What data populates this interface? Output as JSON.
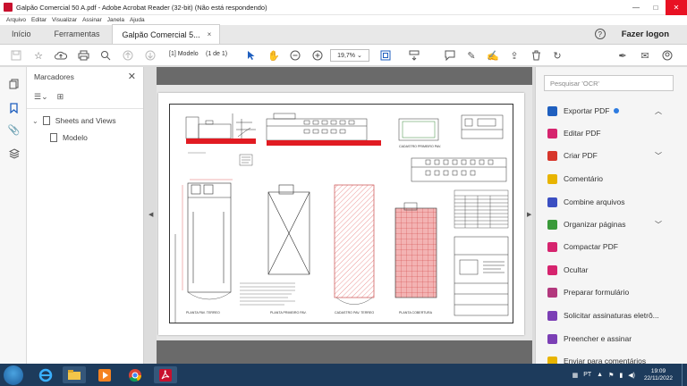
{
  "window": {
    "title": "Galpão Comercial 50 A.pdf - Adobe Acrobat Reader (32-bit) (Não está respondendo)",
    "minimize": "—",
    "maximize": "□",
    "close": "✕"
  },
  "menu": [
    "Arquivo",
    "Editar",
    "Visualizar",
    "Assinar",
    "Janela",
    "Ajuda"
  ],
  "tabs": {
    "home": "Início",
    "tools": "Ferramentas",
    "document": "Galpão Comercial 5...",
    "document_close": "×",
    "help": "?",
    "login": "Fazer logon"
  },
  "toolbar": {
    "page_label": "[1] Modelo",
    "page_count": "(1 de 1)",
    "zoom": "19,7%"
  },
  "bookmarks": {
    "header": "Marcadores",
    "close": "✕",
    "items": [
      {
        "label": "Sheets and Views",
        "expanded": true
      },
      {
        "label": "Modelo"
      }
    ]
  },
  "tools_pane": {
    "search_placeholder": "Pesquisar 'OCR'",
    "items": [
      {
        "label": "Exportar PDF",
        "color": "#1f5fbf",
        "chevron": "up"
      },
      {
        "label": "Editar PDF",
        "color": "#d6246e"
      },
      {
        "label": "Criar PDF",
        "color": "#d7362b",
        "chevron": "down"
      },
      {
        "label": "Comentário",
        "color": "#e8b400"
      },
      {
        "label": "Combine arquivos",
        "color": "#3b4fc2"
      },
      {
        "label": "Organizar páginas",
        "color": "#3a9a3a",
        "chevron": "down"
      },
      {
        "label": "Compactar PDF",
        "color": "#d6246e"
      },
      {
        "label": "Ocultar",
        "color": "#d6246e"
      },
      {
        "label": "Preparar formulário",
        "color": "#b2387d"
      },
      {
        "label": "Solicitar assinaturas eletrô...",
        "color": "#7b3fb5"
      },
      {
        "label": "Preencher e assinar",
        "color": "#7b3fb5"
      },
      {
        "label": "Enviar para comentários",
        "color": "#e8b400"
      }
    ]
  },
  "drawing": {
    "labels": {
      "cadastro_primeiro": "CADASTRO PRIMEIRO PAV.",
      "planta_terreo": "PLANTA PAV. TERREO",
      "planta_primeiro": "PLANTA PRIMEIRO PAV.",
      "cadastro_terreo": "CADASTRO PAV. TERREO",
      "planta_cobertura": "PLANTA COBERTURA"
    }
  },
  "taskbar": {
    "time": "19:09",
    "date": "22/11/2022",
    "language": "PT"
  }
}
